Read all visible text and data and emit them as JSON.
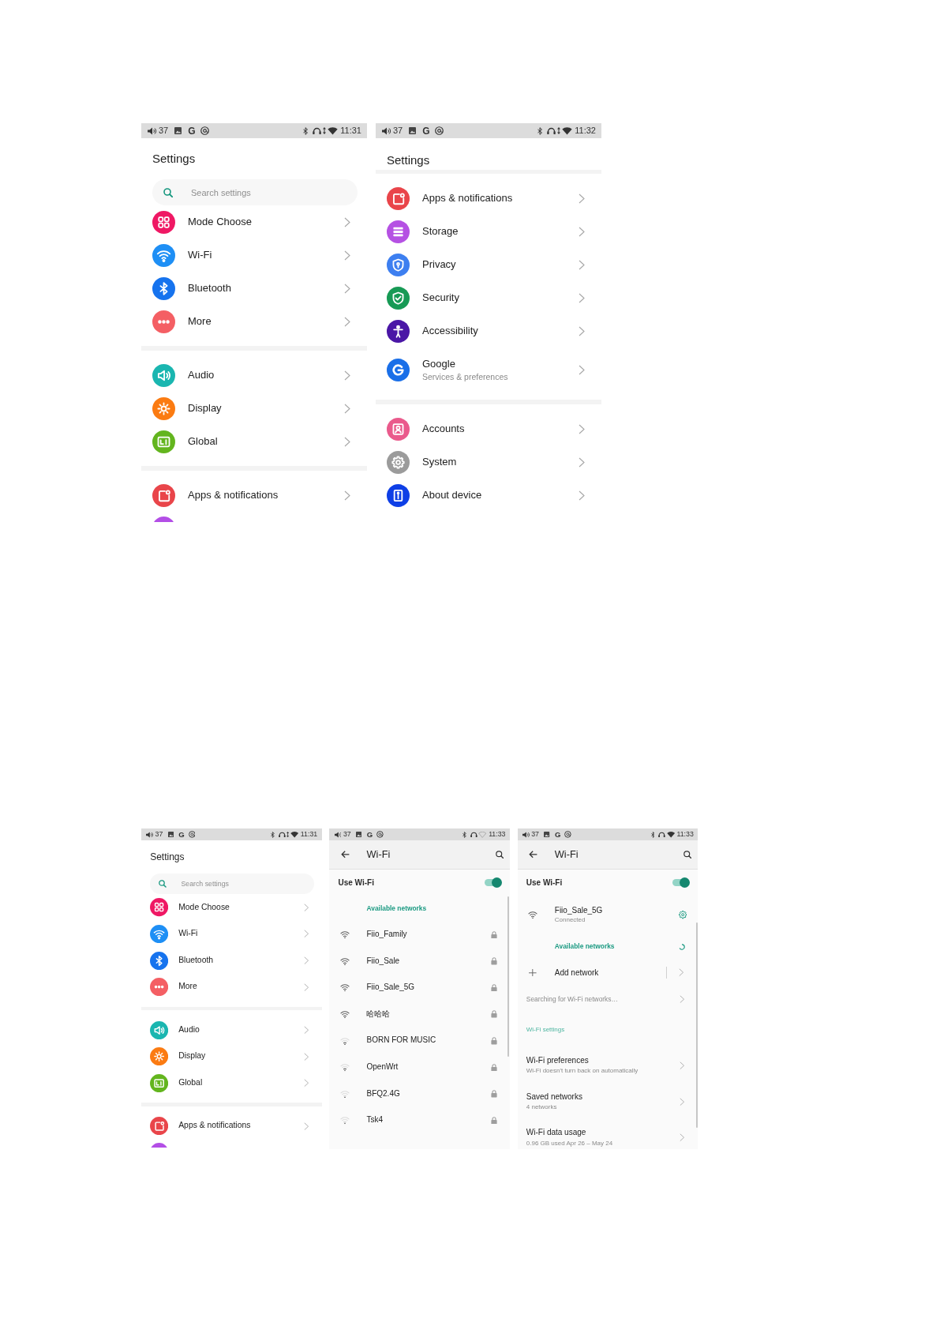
{
  "rows": [
    {
      "screens": [
        {
          "kind": "settings",
          "status_bar": {
            "volume": "37",
            "letter": "G",
            "data_active": true,
            "wifi_connected": true,
            "time": "11:31"
          },
          "title": "Settings",
          "search": {
            "placeholder": "Search settings"
          },
          "groups": [
            {
              "items": [
                {
                  "label": "Mode Choose",
                  "color": "#ef1864"
                },
                {
                  "label": "Wi-Fi",
                  "color": "#1e8ff5"
                },
                {
                  "label": "Bluetooth",
                  "color": "#1673ee"
                },
                {
                  "label": "More",
                  "color": "#f45f64"
                }
              ]
            },
            {
              "items": [
                {
                  "label": "Audio",
                  "color": "#1ab6b0"
                },
                {
                  "label": "Display",
                  "color": "#fb7b12"
                },
                {
                  "label": "Global",
                  "color": "#63b51e"
                }
              ]
            },
            {
              "items": [
                {
                  "label": "Apps & notifications",
                  "color": "#e9454a"
                }
              ]
            }
          ],
          "peek_icon": {
            "color": "#b34ee6"
          }
        },
        {
          "kind": "settings",
          "status_bar": {
            "volume": "37",
            "letter": "G",
            "data_active": true,
            "wifi_connected": true,
            "time": "11:32"
          },
          "title": "Settings",
          "groups": [
            {
              "items": [
                {
                  "label": "Apps & notifications",
                  "color": "#e9454a"
                },
                {
                  "label": "Storage",
                  "color": "#b551e3"
                },
                {
                  "label": "Privacy",
                  "color": "#3d7ff0"
                },
                {
                  "label": "Security",
                  "color": "#179a55"
                },
                {
                  "label": "Accessibility",
                  "color": "#4a16a6"
                },
                {
                  "label": "Google",
                  "subtitle": "Services & preferences",
                  "color": "#1a6fe8"
                }
              ]
            },
            {
              "items": [
                {
                  "label": "Accounts",
                  "color": "#ea5a8c"
                },
                {
                  "label": "System",
                  "color": "#9b9b9b"
                },
                {
                  "label": "About device",
                  "color": "#0e3fe6"
                }
              ]
            }
          ]
        }
      ]
    },
    {
      "screens": [
        {
          "kind": "settings",
          "status_bar": {
            "volume": "37",
            "letter": "G",
            "data_active": true,
            "wifi_connected": true,
            "time": "11:31"
          },
          "title": "Settings",
          "search": {
            "placeholder": "Search settings"
          },
          "groups": [
            {
              "items": [
                {
                  "label": "Mode Choose",
                  "color": "#ef1864"
                },
                {
                  "label": "Wi-Fi",
                  "color": "#1e8ff5"
                },
                {
                  "label": "Bluetooth",
                  "color": "#1673ee"
                },
                {
                  "label": "More",
                  "color": "#f45f64"
                }
              ]
            },
            {
              "items": [
                {
                  "label": "Audio",
                  "color": "#1ab6b0"
                },
                {
                  "label": "Display",
                  "color": "#fb7b12"
                },
                {
                  "label": "Global",
                  "color": "#63b51e"
                }
              ]
            },
            {
              "items": [
                {
                  "label": "Apps & notifications",
                  "color": "#e9454a"
                }
              ]
            }
          ],
          "peek_icon": {
            "color": "#b34ee6"
          }
        },
        {
          "kind": "wifi",
          "status_bar": {
            "volume": "37",
            "letter": "G",
            "data_active": false,
            "wifi_connected": false,
            "time": "11:33"
          },
          "title": "Wi-Fi",
          "use_wifi": {
            "label": "Use Wi-Fi",
            "on": true
          },
          "items": [
            {
              "kind": "header",
              "text": "Available networks",
              "busy": false
            },
            {
              "kind": "network",
              "name": "Fiio_Family",
              "secured": true,
              "connected": false
            },
            {
              "kind": "network",
              "name": "Fiio_Sale",
              "secured": true,
              "connected": false
            },
            {
              "kind": "network",
              "name": "Fiio_Sale_5G",
              "secured": true,
              "connected": false
            },
            {
              "kind": "network",
              "name": "哈哈哈",
              "secured": true,
              "connected": false
            },
            {
              "kind": "fair_network",
              "name": "BORN FOR MUSIC",
              "secured": true,
              "connected": false
            },
            {
              "kind": "fair_network",
              "name": "OpenWrt",
              "secured": true,
              "connected": false
            },
            {
              "kind": "weak_network",
              "name": "BFQ2.4G",
              "secured": true,
              "connected": false
            },
            {
              "kind": "weak_network",
              "name": "Tsk4",
              "secured": true,
              "connected": false
            }
          ]
        },
        {
          "kind": "wifi",
          "status_bar": {
            "volume": "37",
            "letter": "G",
            "data_active": false,
            "wifi_connected": true,
            "time": "11:33"
          },
          "title": "Wi-Fi",
          "use_wifi": {
            "label": "Use Wi-Fi",
            "on": true
          },
          "items": [
            {
              "kind": "network",
              "name": "Fiio_Sale_5G",
              "detail": "Connected",
              "connected": true
            },
            {
              "kind": "header",
              "text": "Available networks",
              "busy": true
            },
            {
              "kind": "add",
              "label": "Add network"
            },
            {
              "kind": "note",
              "text": "Searching for Wi-Fi networks…"
            },
            {
              "kind": "category",
              "text": "Wi-Fi settings"
            },
            {
              "kind": "link",
              "title": "Wi-Fi preferences",
              "subtitle": "Wi-Fi doesn't turn back on automatically"
            },
            {
              "kind": "link",
              "title": "Saved networks",
              "subtitle": "4 networks"
            },
            {
              "kind": "link",
              "title": "Wi-Fi data usage",
              "subtitle": "0.96 GB used Apr 26 – May 24"
            }
          ]
        }
      ]
    }
  ]
}
